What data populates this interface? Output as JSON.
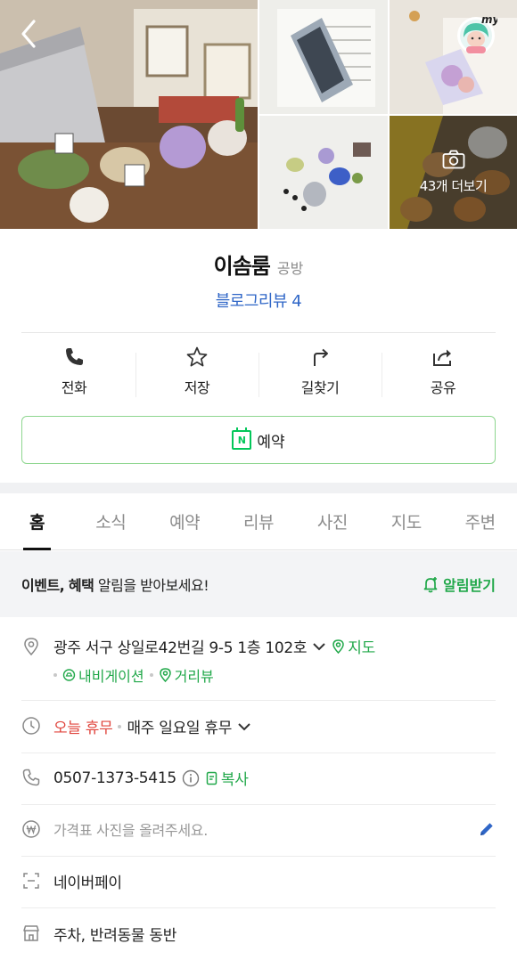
{
  "gallery": {
    "more_label": "43개 더보기",
    "avatar_text": "my"
  },
  "place": {
    "name": "이솜룸",
    "category": "공방",
    "blog_review": "블로그리뷰 4"
  },
  "actions": [
    {
      "label": "전화",
      "icon": "phone-icon"
    },
    {
      "label": "저장",
      "icon": "star-icon"
    },
    {
      "label": "길찾기",
      "icon": "directions-icon"
    },
    {
      "label": "공유",
      "icon": "share-icon"
    }
  ],
  "reserve": {
    "label": "예약",
    "badge": "N"
  },
  "tabs": [
    "홈",
    "소식",
    "예약",
    "리뷰",
    "사진",
    "지도",
    "주변"
  ],
  "alert": {
    "bold1": "이벤트,",
    "bold2": "혜택",
    "rest": "알림을 받아보세요!",
    "button": "알림받기"
  },
  "info": {
    "address": "광주 서구 상일로42번길 9-5 1층 102호",
    "map_link": "지도",
    "navigation_link": "내비게이션",
    "street_view_link": "거리뷰",
    "today_status": "오늘 휴무",
    "schedule": "매주 일요일 휴무",
    "phone": "0507-1373-5415",
    "copy_link": "복사",
    "price_placeholder": "가격표 사진을 올려주세요.",
    "payment": "네이버페이",
    "amenities": "주차, 반려동물 동반"
  },
  "colors": {
    "green": "#21a84a",
    "blue_link": "#2f66c7",
    "closed_red": "#e0463e"
  }
}
